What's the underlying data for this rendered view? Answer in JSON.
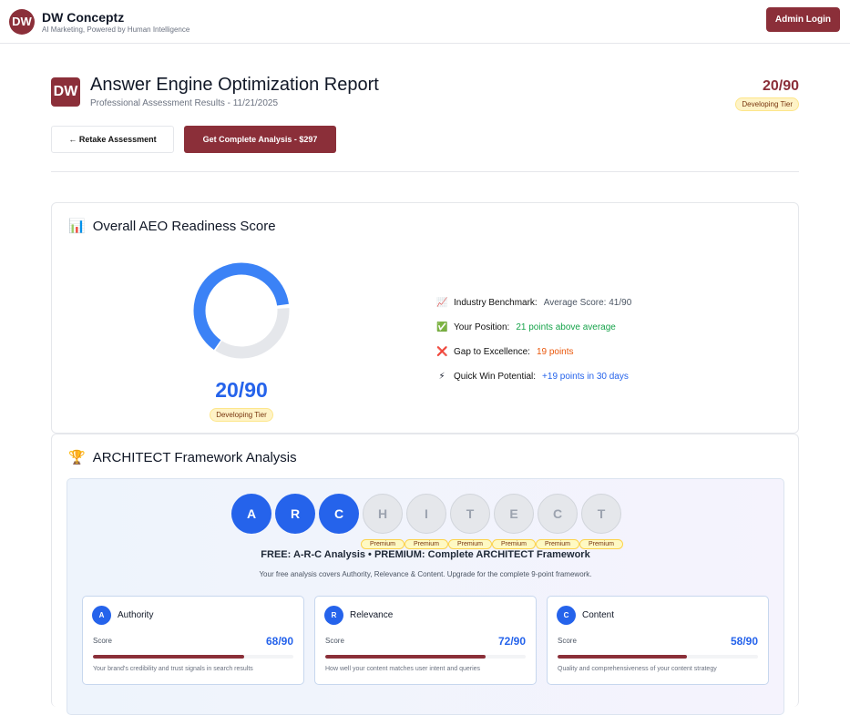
{
  "topbar": {
    "logo": "DW",
    "name": "DW Conceptz",
    "tagline": "AI Marketing, Powered by Human Intelligence",
    "admin_label": "Admin Login"
  },
  "header": {
    "logo": "DW",
    "title": "Answer Engine Optimization Report",
    "subtitle": "Professional Assessment Results - 11/21/2025",
    "score": "20/90",
    "tier": "Developing Tier",
    "retake_label": "← Retake Assessment",
    "cta_label": "Get Complete Analysis - $297"
  },
  "overall": {
    "icon": "bar-chart-icon",
    "title": "Overall AEO Readiness Score",
    "score": "20/90",
    "tier": "Developing Tier",
    "ring_fill": 0.64,
    "colors": {
      "ring": "#3b82f6",
      "track": "#e5e7eb"
    },
    "stats": [
      {
        "icon": "chart-trend-icon",
        "glyph": "📈",
        "label": "Industry Benchmark:",
        "value": "Average Score: 41/90",
        "color": "#4b5563"
      },
      {
        "icon": "check-icon",
        "glyph": "✅",
        "label": "Your Position:",
        "value": "21 points above average",
        "color": "#16a34a"
      },
      {
        "icon": "x-icon",
        "glyph": "❌",
        "label": "Gap to Excellence:",
        "value": "19 points",
        "color": "#ea580c"
      },
      {
        "icon": "lightning-icon",
        "glyph": "⚡",
        "label": "Quick Win Potential:",
        "value": "+19 points in 30 days",
        "color": "#2563eb"
      }
    ]
  },
  "architect": {
    "icon": "trophy-icon",
    "title": "ARCHITECT Framework Analysis",
    "letters": [
      {
        "l": "A",
        "free": true
      },
      {
        "l": "R",
        "free": true
      },
      {
        "l": "C",
        "free": true
      },
      {
        "l": "H",
        "free": false
      },
      {
        "l": "I",
        "free": false
      },
      {
        "l": "T",
        "free": false
      },
      {
        "l": "E",
        "free": false
      },
      {
        "l": "C",
        "free": false
      },
      {
        "l": "T",
        "free": false
      }
    ],
    "premium_label": "Premium",
    "free_line": "FREE: A-R-C Analysis • PREMIUM: Complete ARCHITECT Framework",
    "free_desc": "Your free analysis covers Authority, Relevance & Content. Upgrade for the complete 9-point framework.",
    "cards": [
      {
        "letter": "A",
        "name": "Authority",
        "score_label": "Score",
        "score": "68/90",
        "fraction": 0.756,
        "desc": "Your brand's credibility and trust signals in search results"
      },
      {
        "letter": "R",
        "name": "Relevance",
        "score_label": "Score",
        "score": "72/90",
        "fraction": 0.8,
        "desc": "How well your content matches user intent and queries"
      },
      {
        "letter": "C",
        "name": "Content",
        "score_label": "Score",
        "score": "58/90",
        "fraction": 0.644,
        "desc": "Quality and comprehensiveness of your content strategy"
      }
    ]
  }
}
